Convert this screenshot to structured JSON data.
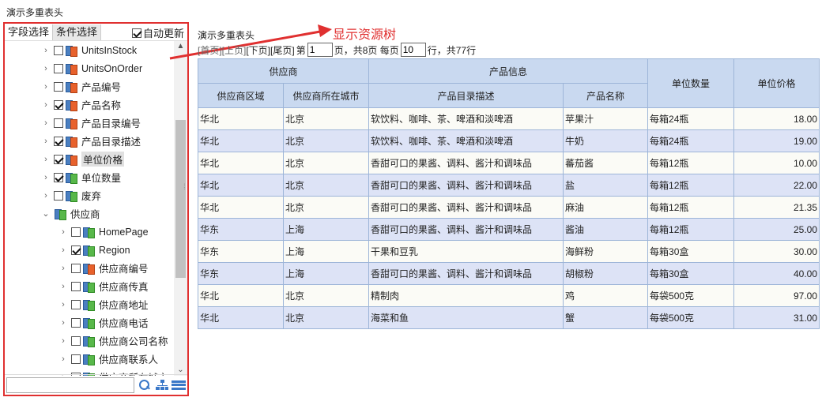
{
  "page_title": "演示多重表头",
  "left_panel": {
    "tabs": [
      "字段选择",
      "条件选择"
    ],
    "auto_update_label": "自动更新",
    "auto_update_checked": true,
    "search_placeholder": "",
    "tree": [
      {
        "label": "UnitsInStock",
        "checked": false,
        "type": "field",
        "level": 1,
        "expanded": false
      },
      {
        "label": "UnitsOnOrder",
        "checked": false,
        "type": "field",
        "level": 1,
        "expanded": false
      },
      {
        "label": "产品编号",
        "checked": false,
        "type": "field",
        "level": 1,
        "expanded": false
      },
      {
        "label": "产品名称",
        "checked": true,
        "type": "field",
        "level": 1,
        "expanded": false
      },
      {
        "label": "产品目录编号",
        "checked": false,
        "type": "field",
        "level": 1,
        "expanded": false
      },
      {
        "label": "产品目录描述",
        "checked": true,
        "type": "field",
        "level": 1,
        "expanded": false
      },
      {
        "label": "单位价格",
        "checked": true,
        "type": "field",
        "level": 1,
        "expanded": false,
        "selected": true
      },
      {
        "label": "单位数量",
        "checked": true,
        "type": "table",
        "level": 1,
        "expanded": false
      },
      {
        "label": "废弃",
        "checked": false,
        "type": "table",
        "level": 1,
        "expanded": false
      },
      {
        "label": "供应商",
        "checked": null,
        "type": "table",
        "level": 0,
        "expanded": true
      },
      {
        "label": "HomePage",
        "checked": false,
        "type": "table",
        "level": 2,
        "expanded": false
      },
      {
        "label": "Region",
        "checked": true,
        "type": "table",
        "level": 2,
        "expanded": false
      },
      {
        "label": "供应商编号",
        "checked": false,
        "type": "field",
        "level": 2,
        "expanded": false
      },
      {
        "label": "供应商传真",
        "checked": false,
        "type": "table",
        "level": 2,
        "expanded": false
      },
      {
        "label": "供应商地址",
        "checked": false,
        "type": "table",
        "level": 2,
        "expanded": false
      },
      {
        "label": "供应商电话",
        "checked": false,
        "type": "table",
        "level": 2,
        "expanded": false
      },
      {
        "label": "供应商公司名称",
        "checked": false,
        "type": "table",
        "level": 2,
        "expanded": false
      },
      {
        "label": "供应商联系人",
        "checked": false,
        "type": "table",
        "level": 2,
        "expanded": false
      },
      {
        "label": "供应商所在城市",
        "checked": true,
        "type": "table",
        "level": 2,
        "expanded": false
      }
    ]
  },
  "annotation": "显示资源树",
  "report": {
    "title": "演示多重表头",
    "pager": {
      "first": "[首页]",
      "prev": "[上页]",
      "next": "[下页]",
      "last": "[尾页]",
      "page_prefix": "第",
      "current_page": "1",
      "page_suffix": "页，共8页 每页",
      "rows_per_page": "10",
      "rows_suffix": "行，共77行"
    },
    "header_groups": [
      {
        "label": "供应商"
      },
      {
        "label": "产品信息"
      },
      {
        "label": "单位数量"
      },
      {
        "label": "单位价格"
      }
    ],
    "columns": [
      "供应商区域",
      "供应商所在城市",
      "产品目录描述",
      "产品名称"
    ],
    "rows": [
      [
        "华北",
        "北京",
        "软饮料、咖啡、茶、啤酒和淡啤酒",
        "苹果汁",
        "每箱24瓶",
        "18.00"
      ],
      [
        "华北",
        "北京",
        "软饮料、咖啡、茶、啤酒和淡啤酒",
        "牛奶",
        "每箱24瓶",
        "19.00"
      ],
      [
        "华北",
        "北京",
        "香甜可口的果酱、调料、酱汁和调味品",
        "蕃茄酱",
        "每箱12瓶",
        "10.00"
      ],
      [
        "华北",
        "北京",
        "香甜可口的果酱、调料、酱汁和调味品",
        "盐",
        "每箱12瓶",
        "22.00"
      ],
      [
        "华北",
        "北京",
        "香甜可口的果酱、调料、酱汁和调味品",
        "麻油",
        "每箱12瓶",
        "21.35"
      ],
      [
        "华东",
        "上海",
        "香甜可口的果酱、调料、酱汁和调味品",
        "酱油",
        "每箱12瓶",
        "25.00"
      ],
      [
        "华东",
        "上海",
        "干果和豆乳",
        "海鲜粉",
        "每箱30盒",
        "30.00"
      ],
      [
        "华东",
        "上海",
        "香甜可口的果酱、调料、酱汁和调味品",
        "胡椒粉",
        "每箱30盒",
        "40.00"
      ],
      [
        "华北",
        "北京",
        "精制肉",
        "鸡",
        "每袋500克",
        "97.00"
      ],
      [
        "华北",
        "北京",
        "海菜和鱼",
        "蟹",
        "每袋500克",
        "31.00"
      ]
    ]
  },
  "colors": {
    "highlight_border": "#e03030",
    "header_bg": "#c9d9f0",
    "row_alt_bg": "#dde3f6",
    "row_bg": "#fbfbf6"
  }
}
